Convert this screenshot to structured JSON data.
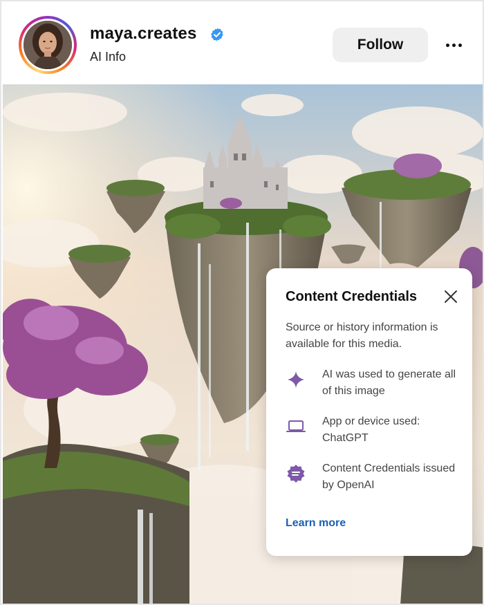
{
  "header": {
    "username": "maya.creates",
    "subtitle": "AI Info",
    "follow_label": "Follow"
  },
  "icons": {
    "verified": "verified-badge-icon",
    "more": "more-options-icon",
    "close": "close-icon",
    "sparkle": "sparkle-icon",
    "laptop": "laptop-icon",
    "credential": "credential-badge-icon"
  },
  "colors": {
    "verified_blue": "#3897f0",
    "icon_purple": "#7d59a8",
    "link_blue": "#1d5fb4"
  },
  "popup": {
    "title": "Content Credentials",
    "description": "Source or history information is available for this media.",
    "items": [
      {
        "text": "AI was used to generate all of this image"
      },
      {
        "text": "App or device used: ChatGPT"
      },
      {
        "text": "Content Credentials issued by OpenAI"
      }
    ],
    "learn_more": "Learn more"
  }
}
